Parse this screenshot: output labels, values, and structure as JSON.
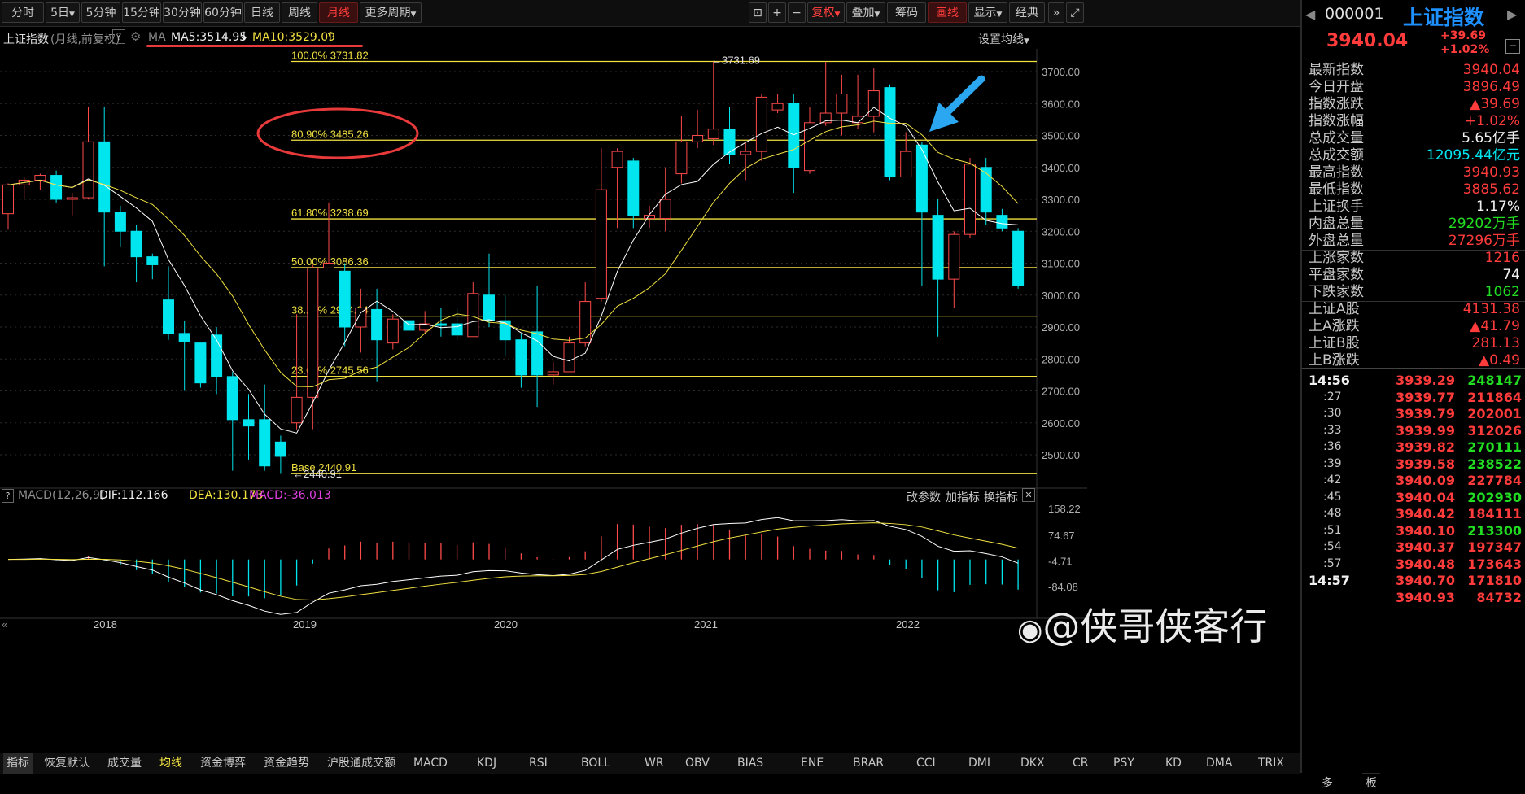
{
  "toolbar": {
    "periods": [
      "分时",
      "5日",
      "5分钟",
      "15分钟",
      "30分钟",
      "60分钟",
      "日线",
      "周线",
      "月线",
      "更多周期"
    ],
    "active_period": "月线",
    "tools": [
      "复权",
      "叠加",
      "筹码",
      "画线",
      "显示",
      "经典"
    ]
  },
  "info": {
    "index_name": "上证指数",
    "mode": "(月线,前复权)",
    "help": "?",
    "ma_label": "MA",
    "ma5": "MA5:3514.95",
    "ma10": "MA10:3529.09",
    "settings": "设置均线"
  },
  "chart": {
    "y_ticks": [
      "3700.00",
      "3600.00",
      "3500.00",
      "3400.00",
      "3300.00",
      "3200.00",
      "3100.00",
      "3000.00",
      "2900.00",
      "2800.00",
      "2700.00",
      "2600.00",
      "2500.00"
    ],
    "x_ticks": [
      "2018",
      "2019",
      "2020",
      "2021",
      "2022"
    ],
    "fib_levels": [
      {
        "label": "100.0% 3731.82",
        "value": 3731.82
      },
      {
        "label": "80.90% 3485.26",
        "value": 3485.26
      },
      {
        "label": "61.80% 3238.69",
        "value": 3238.69
      },
      {
        "label": "50.00% 3086.36",
        "value": 3086.36
      },
      {
        "label": "38.20% 2934.04",
        "value": 2934.04
      },
      {
        "label": "23.60% 2745.56",
        "value": 2745.56
      },
      {
        "label": "Base  2440.91",
        "value": 2440.91
      }
    ],
    "high_marker": "←3731.69",
    "low_marker": "←2440.91"
  },
  "chart_data": {
    "type": "candlestick",
    "title": "上证指数 (月线,前复权)",
    "ylim": [
      2440,
      3760
    ],
    "candles": [
      [
        3255,
        3345,
        3205,
        3350
      ],
      [
        3345,
        3360,
        3300,
        3370
      ],
      [
        3360,
        3375,
        3330,
        3380
      ],
      [
        3375,
        3300,
        3290,
        3390
      ],
      [
        3300,
        3305,
        3250,
        3320
      ],
      [
        3305,
        3480,
        3300,
        3590
      ],
      [
        3480,
        3260,
        3090,
        3590
      ],
      [
        3260,
        3200,
        3150,
        3280
      ],
      [
        3200,
        3120,
        3040,
        3220
      ],
      [
        3120,
        3095,
        3050,
        3130
      ],
      [
        2985,
        2880,
        2860,
        3090
      ],
      [
        2880,
        2855,
        2700,
        2920
      ],
      [
        2850,
        2725,
        2710,
        2850
      ],
      [
        2875,
        2745,
        2690,
        2900
      ],
      [
        2745,
        2610,
        2450,
        2760
      ],
      [
        2610,
        2590,
        2485,
        2690
      ],
      [
        2610,
        2465,
        2450,
        2720
      ],
      [
        2540,
        2495,
        2440,
        2560
      ],
      [
        2600,
        2680,
        2580,
        2940
      ],
      [
        2680,
        3085,
        2580,
        3095
      ],
      [
        3085,
        3100,
        3090,
        3290
      ],
      [
        3075,
        2900,
        2840,
        3100
      ],
      [
        2900,
        2960,
        2820,
        3020
      ],
      [
        2955,
        2860,
        2730,
        3020
      ],
      [
        2850,
        2925,
        2830,
        2940
      ],
      [
        2920,
        2890,
        2860,
        2970
      ],
      [
        2890,
        2910,
        2880,
        2950
      ],
      [
        2910,
        2905,
        2870,
        2960
      ],
      [
        2910,
        2875,
        2860,
        2960
      ],
      [
        2870,
        3005,
        2870,
        3040
      ],
      [
        3000,
        2920,
        2900,
        3130
      ],
      [
        2920,
        2860,
        2810,
        3000
      ],
      [
        2860,
        2750,
        2710,
        2880
      ],
      [
        2885,
        2750,
        2650,
        3030
      ],
      [
        2750,
        2760,
        2720,
        2790
      ],
      [
        2760,
        2850,
        2760,
        2870
      ],
      [
        2850,
        2980,
        2840,
        3040
      ],
      [
        2990,
        3330,
        2980,
        3460
      ],
      [
        3400,
        3450,
        3210,
        3460
      ],
      [
        3420,
        3250,
        3210,
        3430
      ],
      [
        3240,
        3250,
        3210,
        3280
      ],
      [
        3240,
        3300,
        3200,
        3400
      ],
      [
        3380,
        3480,
        3350,
        3560
      ],
      [
        3480,
        3500,
        3460,
        3580
      ],
      [
        3490,
        3520,
        3470,
        3730
      ],
      [
        3520,
        3440,
        3410,
        3590
      ],
      [
        3440,
        3450,
        3360,
        3480
      ],
      [
        3450,
        3620,
        3420,
        3630
      ],
      [
        3580,
        3600,
        3570,
        3630
      ],
      [
        3600,
        3400,
        3320,
        3630
      ],
      [
        3390,
        3540,
        3380,
        3590
      ],
      [
        3540,
        3570,
        3530,
        3730
      ],
      [
        3570,
        3630,
        3500,
        3690
      ],
      [
        3540,
        3560,
        3520,
        3690
      ],
      [
        3560,
        3640,
        3510,
        3710
      ],
      [
        3650,
        3370,
        3360,
        3660
      ],
      [
        3370,
        3450,
        3420,
        3510
      ],
      [
        3470,
        3260,
        3030,
        3480
      ],
      [
        3250,
        3050,
        2870,
        3300
      ],
      [
        3050,
        3190,
        2960,
        3200
      ],
      [
        3190,
        3410,
        3180,
        3430
      ],
      [
        3400,
        3260,
        3220,
        3430
      ],
      [
        3250,
        3210,
        3200,
        3270
      ],
      [
        3200,
        3030,
        3020,
        3210
      ]
    ],
    "ma5_last": 3514.95,
    "ma10_last": 3529.09,
    "macd": {
      "params": "MACD(12,26,9)",
      "dif": 112.166,
      "dea": 130.173,
      "macd": -36.013,
      "y_ticks": [
        "158.22",
        "74.67",
        "-4.71",
        "-84.08"
      ]
    }
  },
  "macd_bar": {
    "label": "MACD(12,26,9)",
    "dif": "DIF:112.166",
    "dea": "DEA:130.173",
    "macd": "MACD:-36.013",
    "actions": [
      "改参数",
      "加指标",
      "换指标"
    ]
  },
  "bottom_tabs": [
    "指标",
    "恢复默认",
    "成交量",
    "均线",
    "资金博弈",
    "资金趋势",
    "沪股通成交额",
    "MACD",
    "KDJ",
    "RSI",
    "BOLL",
    "WR",
    "OBV",
    "BIAS",
    "ENE",
    "BRAR",
    "CCI",
    "DMI",
    "DKX",
    "CR",
    "PSY",
    "KD",
    "DMA",
    "TRIX",
    "更多",
    "模板"
  ],
  "active_bottom_tab": "均线",
  "right": {
    "code": "000001",
    "name": "上证指数",
    "price": "3940.04",
    "change": "+39.69",
    "change_pct": "+1.02%",
    "stats": [
      {
        "label": "最新指数",
        "value": "3940.04",
        "color": "red"
      },
      {
        "label": "今日开盘",
        "value": "3896.49",
        "color": "red"
      },
      {
        "label": "指数涨跌",
        "value": "▲39.69",
        "color": "red"
      },
      {
        "label": "指数涨幅",
        "value": "+1.02%",
        "color": "red"
      },
      {
        "label": "总成交量",
        "value": "5.65亿手",
        "color": "white"
      },
      {
        "label": "总成交额",
        "value": "12095.44亿元",
        "color": "cyan"
      },
      {
        "label": "最高指数",
        "value": "3940.93",
        "color": "red"
      },
      {
        "label": "最低指数",
        "value": "3885.62",
        "color": "red"
      },
      {
        "label": "上证换手",
        "value": "1.17%",
        "color": "white"
      },
      {
        "label": "内盘总量",
        "value": "29202万手",
        "color": "green"
      },
      {
        "label": "外盘总量",
        "value": "27296万手",
        "color": "red"
      },
      {
        "label": "上涨家数",
        "value": "1216",
        "color": "red"
      },
      {
        "label": "平盘家数",
        "value": "74",
        "color": "white"
      },
      {
        "label": "下跌家数",
        "value": "1062",
        "color": "green"
      },
      {
        "label": "上证A股",
        "value": "4131.38",
        "color": "red"
      },
      {
        "label": "上A涨跌",
        "value": "▲41.79",
        "color": "red"
      },
      {
        "label": "上证B股",
        "value": "281.13",
        "color": "red"
      },
      {
        "label": "上B涨跌",
        "value": "▲0.49",
        "color": "red"
      }
    ],
    "ticks": [
      {
        "t": "14:56",
        "p": "3939.29",
        "v": "248147",
        "vc": "green",
        "bold": true
      },
      {
        "t": ":27",
        "p": "3939.77",
        "v": "211864",
        "vc": "red"
      },
      {
        "t": ":30",
        "p": "3939.79",
        "v": "202001",
        "vc": "red"
      },
      {
        "t": ":33",
        "p": "3939.99",
        "v": "312026",
        "vc": "red"
      },
      {
        "t": ":36",
        "p": "3939.82",
        "v": "270111",
        "vc": "green"
      },
      {
        "t": ":39",
        "p": "3939.58",
        "v": "238522",
        "vc": "green"
      },
      {
        "t": ":42",
        "p": "3940.09",
        "v": "227784",
        "vc": "red"
      },
      {
        "t": ":45",
        "p": "3940.04",
        "v": "202930",
        "vc": "green"
      },
      {
        "t": ":48",
        "p": "3940.42",
        "v": "184111",
        "vc": "red"
      },
      {
        "t": ":51",
        "p": "3940.10",
        "v": "213300",
        "vc": "green"
      },
      {
        "t": ":54",
        "p": "3940.37",
        "v": "197347",
        "vc": "red"
      },
      {
        "t": ":57",
        "p": "3940.48",
        "v": "173643",
        "vc": "red"
      },
      {
        "t": "14:57",
        "p": "3940.70",
        "v": "171810",
        "vc": "red",
        "bold": true
      },
      {
        "t": "",
        "p": "3940.93",
        "v": "84732",
        "vc": "red"
      },
      {
        "t": "",
        "p": "",
        "v": "",
        "vc": "red"
      }
    ]
  },
  "watermark": "@侠哥侠客行"
}
